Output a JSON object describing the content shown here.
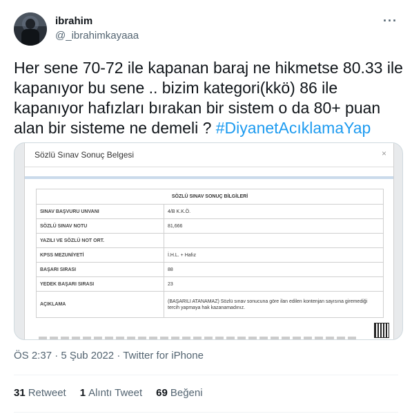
{
  "author": {
    "name": "ibrahim",
    "handle": "@_ibrahimkayaaa"
  },
  "tweet": {
    "text": "Her sene 70-72 ile kapanan baraj ne hikmetse 80.33 ile kapanıyor bu sene .. bizim kategori(kkö) 86 ile kapanıyor hafızları bırakan bir sistem o da 80+ puan alan bir sisteme ne demeli ? ",
    "hashtag": "#DiyanetAcıklamaYap"
  },
  "media": {
    "window_title": "Sözlü Sınav Sonuç Belgesi",
    "close": "×",
    "table_title": "SÖZLÜ SINAV SONUÇ BİLGİLERİ",
    "rows": [
      {
        "key": "SINAV BAŞVURU UNVANI",
        "value": "4/B K.K.Ö."
      },
      {
        "key": "SÖZLÜ SINAV NOTU",
        "value": "81,666"
      },
      {
        "key": "YAZILI VE SÖZLÜ NOT ORT.",
        "value": ""
      },
      {
        "key": "KPSS MEZUNİYETİ",
        "value": "İ.H.L. + Hafız"
      },
      {
        "key": "BAŞARI SIRASI",
        "value": "88"
      },
      {
        "key": "YEDEK BAŞARI SIRASI",
        "value": "23"
      },
      {
        "key": "AÇIKLAMA",
        "value": "(BAŞARILI ATANAMAZ) Sözlü sınav sonucuna göre ilan edilen kontenjan sayısına giremediği tercih yapmaya hak kazanamadınız."
      }
    ]
  },
  "meta": {
    "time": "ÖS 2:37",
    "date": "5 Şub 2022",
    "source": "Twitter for iPhone",
    "separator": "·"
  },
  "stats": {
    "retweets_count": "31",
    "retweets_label": "Retweet",
    "quotes_count": "1",
    "quotes_label": "Alıntı Tweet",
    "likes_count": "69",
    "likes_label": "Beğeni"
  },
  "colors": {
    "accent": "#1d9bf0",
    "secondary_text": "#536471"
  }
}
